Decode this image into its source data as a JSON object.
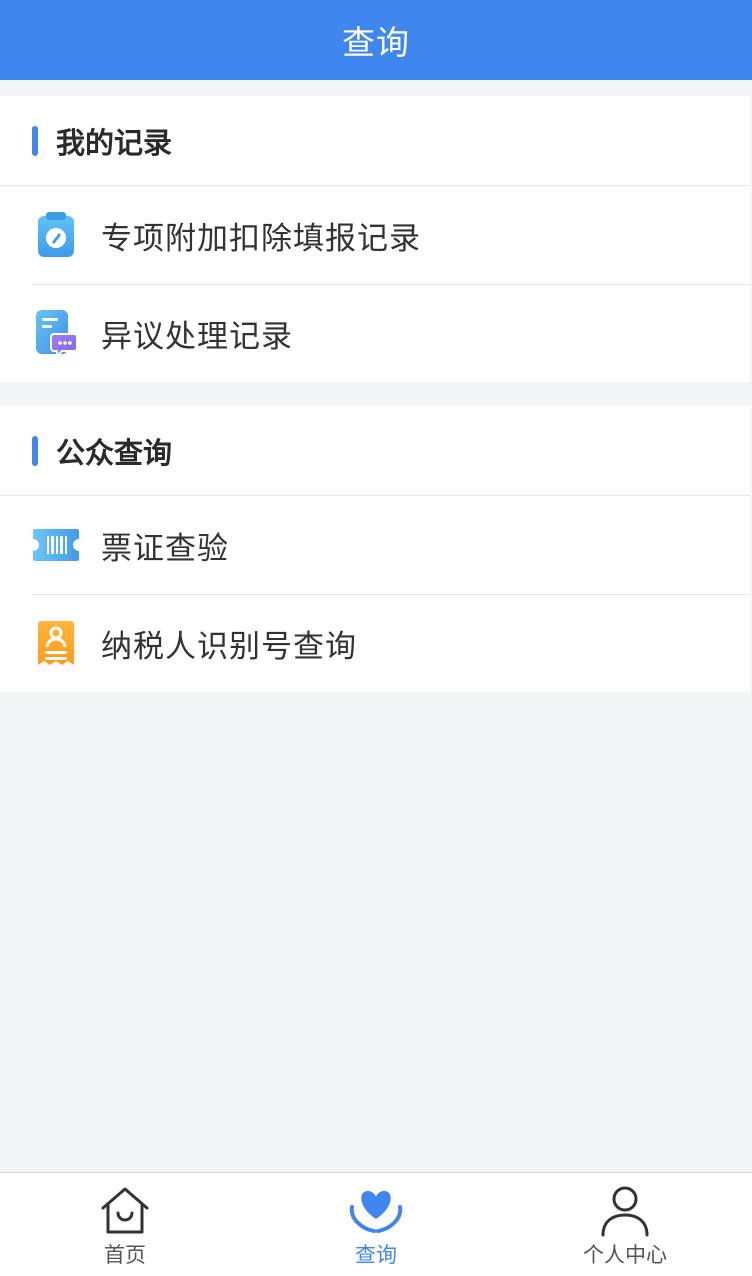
{
  "header": {
    "title": "查询"
  },
  "sections": [
    {
      "title": "我的记录",
      "items": [
        {
          "label": "专项附加扣除填报记录",
          "icon": "clipboard-pen-icon"
        },
        {
          "label": "异议处理记录",
          "icon": "document-message-icon"
        }
      ]
    },
    {
      "title": "公众查询",
      "items": [
        {
          "label": "票证查验",
          "icon": "ticket-barcode-icon"
        },
        {
          "label": "纳税人识别号查询",
          "icon": "taxpayer-id-icon"
        }
      ]
    }
  ],
  "tabbar": {
    "tabs": [
      {
        "label": "首页",
        "icon": "home-icon",
        "active": false
      },
      {
        "label": "查询",
        "icon": "heart-hands-icon",
        "active": true
      },
      {
        "label": "个人中心",
        "icon": "person-icon",
        "active": false
      }
    ]
  },
  "colors": {
    "accent": "#3f87ef",
    "background": "#f4f5f7"
  }
}
